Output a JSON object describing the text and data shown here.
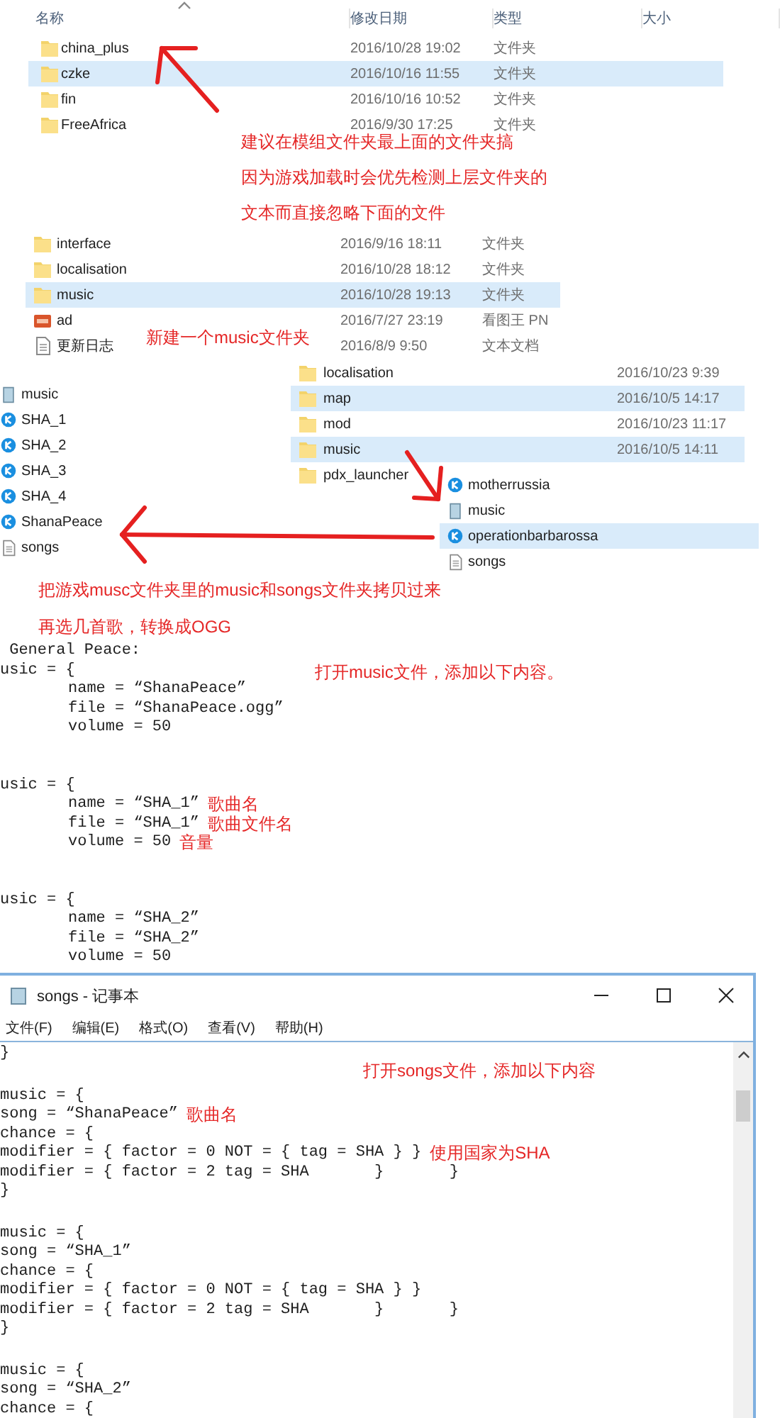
{
  "explorer_top": {
    "columns": [
      "名称",
      "修改日期",
      "类型",
      "大小"
    ],
    "rows": [
      {
        "kind": "folder",
        "name": "china_plus",
        "date": "2016/10/28 19:02",
        "type": "文件夹",
        "selected": false
      },
      {
        "kind": "folder",
        "name": "czke",
        "date": "2016/10/16 11:55",
        "type": "文件夹",
        "selected": true
      },
      {
        "kind": "folder",
        "name": "fin",
        "date": "2016/10/16 10:52",
        "type": "文件夹",
        "selected": false
      },
      {
        "kind": "folder",
        "name": "FreeAfrica",
        "date": "2016/9/30 17:25",
        "type": "文件夹",
        "selected": false
      }
    ],
    "notes": [
      "建议在模组文件夹最上面的文件夹搞",
      "因为游戏加载时会优先检测上层文件夹的",
      "文本而直接忽略下面的文件"
    ]
  },
  "explorer_mod": {
    "rows": [
      {
        "kind": "folder",
        "name": "interface",
        "date": "2016/9/16 18:11",
        "type": "文件夹",
        "selected": false
      },
      {
        "kind": "folder",
        "name": "localisation",
        "date": "2016/10/28 18:12",
        "type": "文件夹",
        "selected": false
      },
      {
        "kind": "folder",
        "name": "music",
        "date": "2016/10/28 19:13",
        "type": "文件夹",
        "selected": true
      },
      {
        "kind": "image",
        "name": "ad",
        "date": "2016/7/27 23:19",
        "type": "看图王 PN",
        "selected": false
      },
      {
        "kind": "text",
        "name": "更新日志",
        "date": "2016/8/9 9:50",
        "type": "文本文档",
        "selected": false
      }
    ],
    "note": "新建一个music文件夹"
  },
  "mod_music_folder": {
    "rows": [
      {
        "kind": "config",
        "name": "music",
        "selected": false
      },
      {
        "kind": "audio",
        "name": "SHA_1",
        "selected": false
      },
      {
        "kind": "audio",
        "name": "SHA_2",
        "selected": false
      },
      {
        "kind": "audio",
        "name": "SHA_3",
        "selected": false
      },
      {
        "kind": "audio",
        "name": "SHA_4",
        "selected": false
      },
      {
        "kind": "audio",
        "name": "ShanaPeace",
        "selected": false
      },
      {
        "kind": "text",
        "name": "songs",
        "selected": false
      }
    ]
  },
  "game_folder": {
    "rows": [
      {
        "kind": "folder",
        "name": "localisation",
        "date": "2016/10/23 9:39",
        "selected": false
      },
      {
        "kind": "folder",
        "name": "map",
        "date": "2016/10/5 14:17",
        "selected": true
      },
      {
        "kind": "folder",
        "name": "mod",
        "date": "2016/10/23 11:17",
        "selected": false
      },
      {
        "kind": "folder",
        "name": "music",
        "date": "2016/10/5 14:11",
        "selected": true
      },
      {
        "kind": "folder",
        "name": "pdx_launcher",
        "selected": false
      }
    ]
  },
  "game_music_folder": {
    "rows": [
      {
        "kind": "audio",
        "name": "motherrussia",
        "selected": false
      },
      {
        "kind": "config",
        "name": "music",
        "selected": false
      },
      {
        "kind": "audio",
        "name": "operationbarbarossa",
        "selected": true
      },
      {
        "kind": "text",
        "name": "songs",
        "selected": false
      }
    ]
  },
  "copy_notes": [
    "把游戏musc文件夹里的music和songs文件夹拷贝过来",
    "再选几首歌，转换成OGG"
  ],
  "music_file": {
    "note": "打开music文件，添加以下内容。",
    "blocks": [
      [
        {
          "code": " General Peace:"
        },
        {
          "code": "usic = {"
        },
        {
          "code": "\tname = “ShanaPeace”"
        },
        {
          "code": "\tfile = “ShanaPeace.ogg”"
        },
        {
          "code": "\tvolume = 50"
        }
      ],
      [
        {
          "code": "usic = {"
        },
        {
          "code": "\tname = “SHA_1”",
          "note": "歌曲名"
        },
        {
          "code": "\tfile = “SHA_1”",
          "note": "歌曲文件名"
        },
        {
          "code": "\tvolume = 50",
          "note": "音量"
        }
      ],
      [
        {
          "code": "usic = {"
        },
        {
          "code": "\tname = “SHA_2”"
        },
        {
          "code": "\tfile = “SHA_2”"
        },
        {
          "code": "\tvolume = 50"
        }
      ]
    ]
  },
  "notepad": {
    "title": "songs - 记事本",
    "menu": [
      "文件(F)",
      "编辑(E)",
      "格式(O)",
      "查看(V)",
      "帮助(H)"
    ],
    "note": "打开songs文件，添加以下内容",
    "blocks": [
      [
        {
          "code": "}"
        }
      ],
      [
        {
          "code": "music = {"
        },
        {
          "code": "song = “ShanaPeace”",
          "note": "歌曲名"
        },
        {
          "code": "chance = {"
        },
        {
          "code": "modifier = { factor = 0 NOT = { tag = SHA } }",
          "note": "使用国家为SHA"
        },
        {
          "code": "modifier = { factor = 2 tag = SHA       }       }"
        },
        {
          "code": "}"
        }
      ],
      [
        {
          "code": "music = {"
        },
        {
          "code": "song = “SHA_1”"
        },
        {
          "code": "chance = {"
        },
        {
          "code": "modifier = { factor = 0 NOT = { tag = SHA } }"
        },
        {
          "code": "modifier = { factor = 2 tag = SHA       }       }"
        },
        {
          "code": "}"
        }
      ],
      [
        {
          "code": "music = {"
        },
        {
          "code": "song = “SHA_2”"
        },
        {
          "code": "chance = {"
        }
      ]
    ]
  }
}
